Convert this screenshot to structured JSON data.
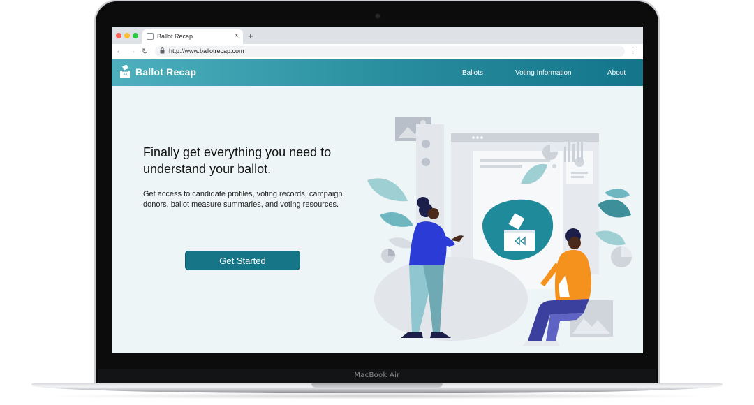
{
  "device": {
    "label": "MacBook Air"
  },
  "browser": {
    "tab_title": "Ballot Recap",
    "tab_close": "×",
    "new_tab": "+",
    "url": "http://www.ballotrecap.com",
    "nav": {
      "back": "←",
      "forward": "→",
      "reload": "↻",
      "menu": "⋮",
      "lock": "🔒"
    }
  },
  "site": {
    "brand": "Ballot Recap",
    "nav": [
      {
        "label": "Ballots"
      },
      {
        "label": "Voting Information"
      },
      {
        "label": "About"
      }
    ],
    "hero": {
      "headline": "Finally get everything you need to understand your ballot.",
      "body": "Get access to candidate profiles, voting records, campaign donors, ballot measure summaries, and voting resources.",
      "cta": "Get Started"
    }
  },
  "colors": {
    "header_start": "#4eb0bd",
    "header_end": "#14758a",
    "cta": "#167688",
    "page_bg": "#eef5f6",
    "figure_blue": "#2a3bd6",
    "figure_orange": "#f5921e"
  },
  "icons": [
    "ballot-box-logo-icon",
    "back-arrow-icon",
    "forward-arrow-icon",
    "reload-icon",
    "lock-icon",
    "menu-dots-icon",
    "tab-close-icon",
    "new-tab-icon"
  ]
}
